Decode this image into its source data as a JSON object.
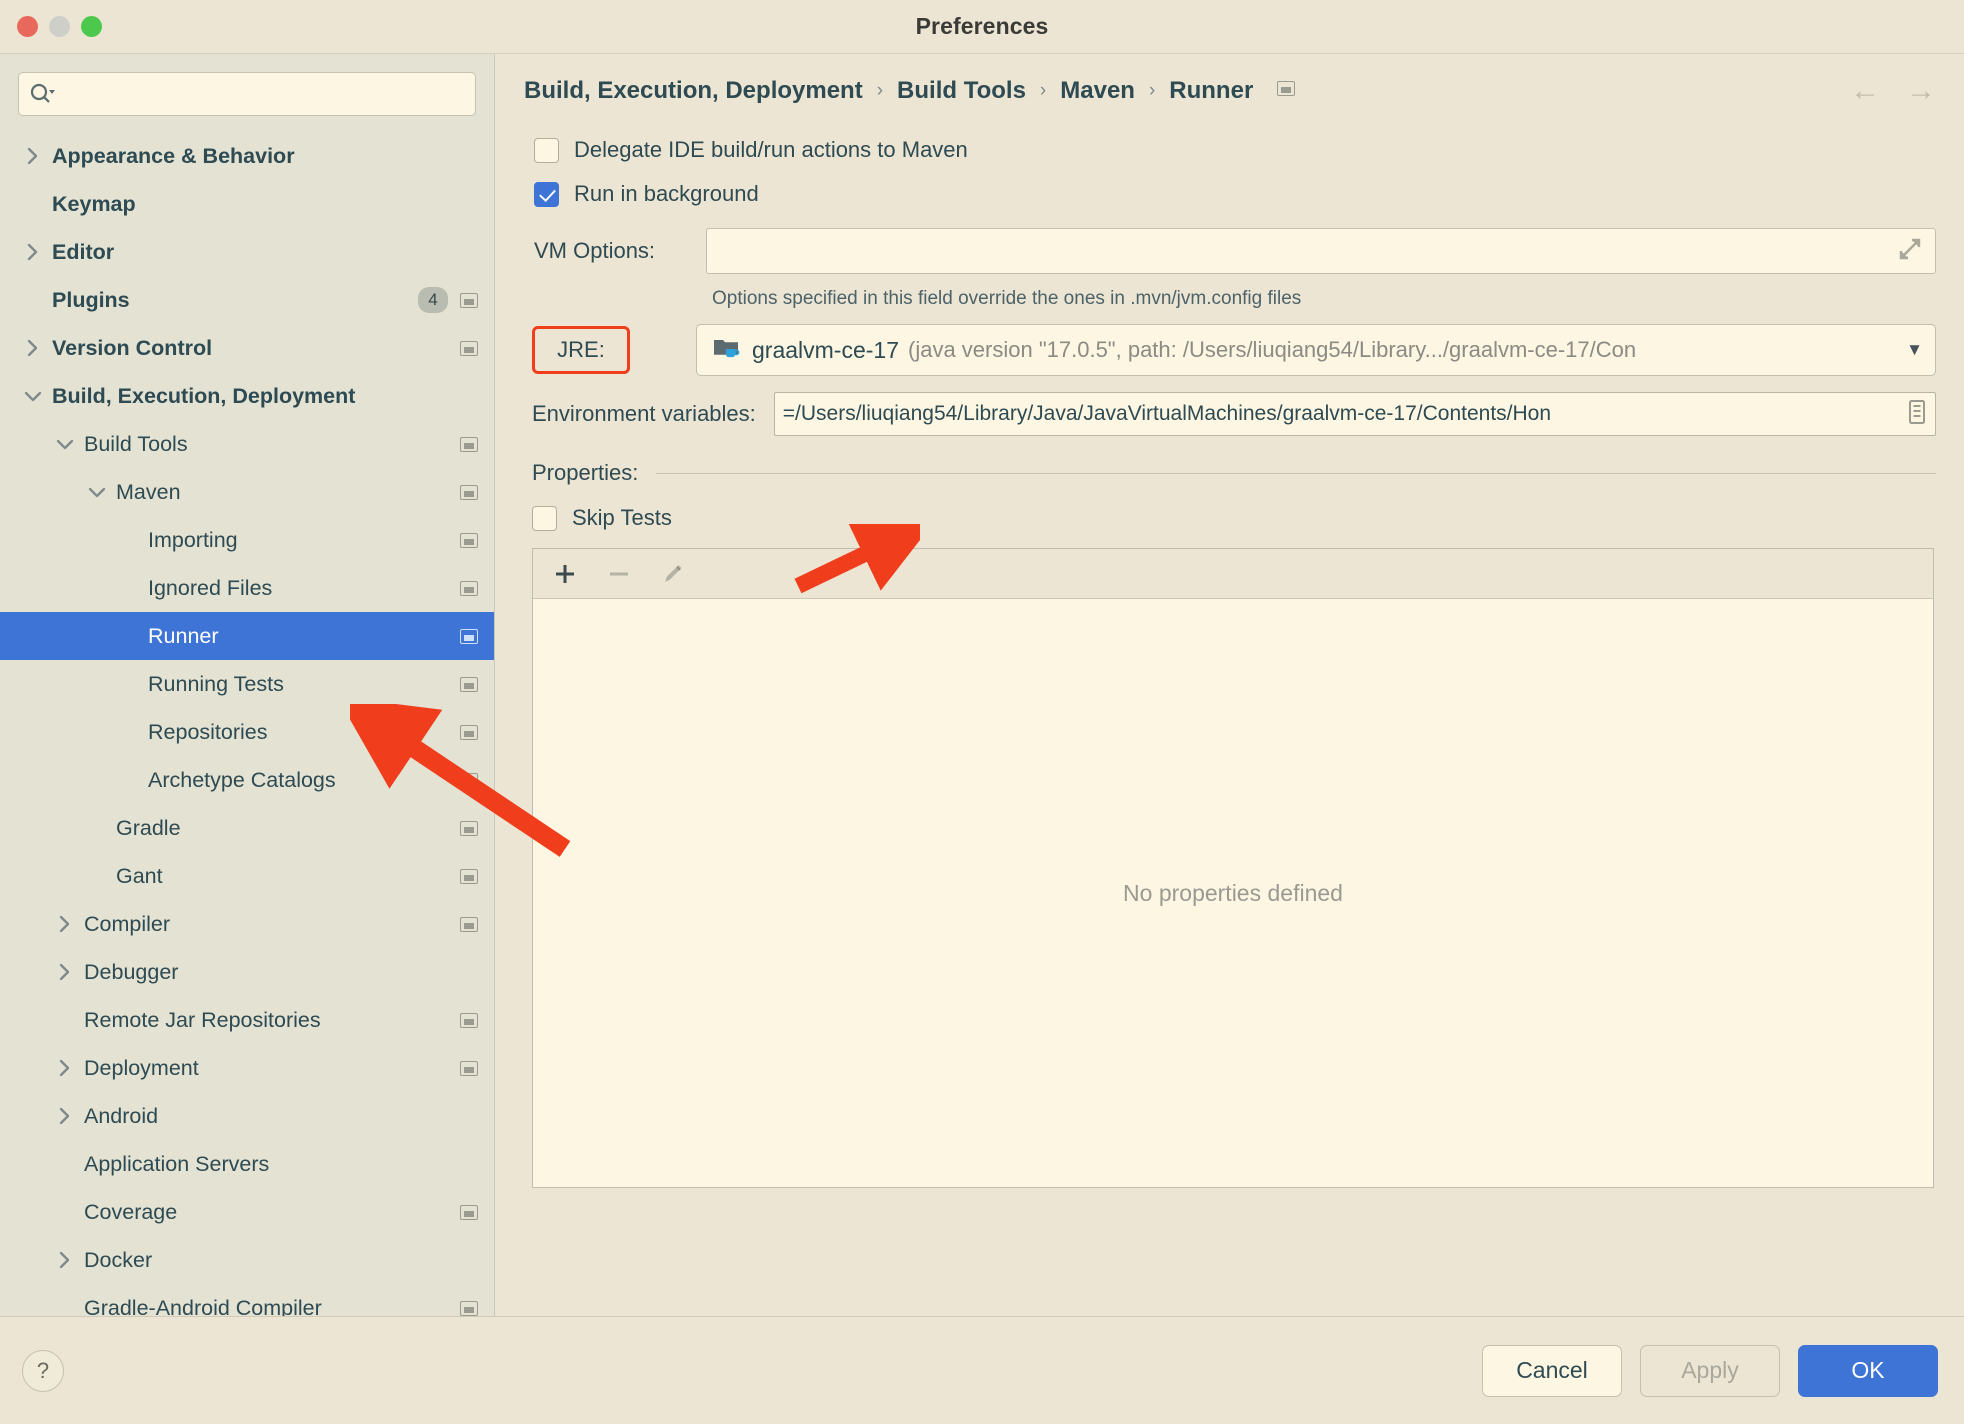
{
  "window": {
    "title": "Preferences",
    "traffic_lights": [
      "close",
      "minimize",
      "maximize"
    ]
  },
  "sidebar": {
    "search": {
      "value": "",
      "placeholder": ""
    },
    "items": [
      {
        "label": "Appearance & Behavior",
        "indent": 0,
        "arrow": "right",
        "bold": true,
        "badge": null,
        "icon": false,
        "selected": false
      },
      {
        "label": "Keymap",
        "indent": 0,
        "arrow": "none",
        "bold": true,
        "badge": null,
        "icon": false,
        "selected": false
      },
      {
        "label": "Editor",
        "indent": 0,
        "arrow": "right",
        "bold": true,
        "badge": null,
        "icon": false,
        "selected": false
      },
      {
        "label": "Plugins",
        "indent": 0,
        "arrow": "none",
        "bold": true,
        "badge": "4",
        "icon": true,
        "selected": false
      },
      {
        "label": "Version Control",
        "indent": 0,
        "arrow": "right",
        "bold": true,
        "badge": null,
        "icon": true,
        "selected": false
      },
      {
        "label": "Build, Execution, Deployment",
        "indent": 0,
        "arrow": "down",
        "bold": true,
        "badge": null,
        "icon": false,
        "selected": false
      },
      {
        "label": "Build Tools",
        "indent": 1,
        "arrow": "down",
        "bold": false,
        "badge": null,
        "icon": true,
        "selected": false
      },
      {
        "label": "Maven",
        "indent": 2,
        "arrow": "down",
        "bold": false,
        "badge": null,
        "icon": true,
        "selected": false
      },
      {
        "label": "Importing",
        "indent": 3,
        "arrow": "none",
        "bold": false,
        "badge": null,
        "icon": true,
        "selected": false
      },
      {
        "label": "Ignored Files",
        "indent": 3,
        "arrow": "none",
        "bold": false,
        "badge": null,
        "icon": true,
        "selected": false
      },
      {
        "label": "Runner",
        "indent": 3,
        "arrow": "none",
        "bold": false,
        "badge": null,
        "icon": true,
        "selected": true
      },
      {
        "label": "Running Tests",
        "indent": 3,
        "arrow": "none",
        "bold": false,
        "badge": null,
        "icon": true,
        "selected": false
      },
      {
        "label": "Repositories",
        "indent": 3,
        "arrow": "none",
        "bold": false,
        "badge": null,
        "icon": true,
        "selected": false
      },
      {
        "label": "Archetype Catalogs",
        "indent": 3,
        "arrow": "none",
        "bold": false,
        "badge": null,
        "icon": true,
        "selected": false
      },
      {
        "label": "Gradle",
        "indent": 2,
        "arrow": "none",
        "bold": false,
        "badge": null,
        "icon": true,
        "selected": false
      },
      {
        "label": "Gant",
        "indent": 2,
        "arrow": "none",
        "bold": false,
        "badge": null,
        "icon": true,
        "selected": false
      },
      {
        "label": "Compiler",
        "indent": 1,
        "arrow": "right",
        "bold": false,
        "badge": null,
        "icon": true,
        "selected": false
      },
      {
        "label": "Debugger",
        "indent": 1,
        "arrow": "right",
        "bold": false,
        "badge": null,
        "icon": false,
        "selected": false
      },
      {
        "label": "Remote Jar Repositories",
        "indent": 1,
        "arrow": "none",
        "bold": false,
        "badge": null,
        "icon": true,
        "selected": false
      },
      {
        "label": "Deployment",
        "indent": 1,
        "arrow": "right",
        "bold": false,
        "badge": null,
        "icon": true,
        "selected": false
      },
      {
        "label": "Android",
        "indent": 1,
        "arrow": "right",
        "bold": false,
        "badge": null,
        "icon": false,
        "selected": false
      },
      {
        "label": "Application Servers",
        "indent": 1,
        "arrow": "none",
        "bold": false,
        "badge": null,
        "icon": false,
        "selected": false
      },
      {
        "label": "Coverage",
        "indent": 1,
        "arrow": "none",
        "bold": false,
        "badge": null,
        "icon": true,
        "selected": false
      },
      {
        "label": "Docker",
        "indent": 1,
        "arrow": "right",
        "bold": false,
        "badge": null,
        "icon": false,
        "selected": false
      },
      {
        "label": "Gradle-Android Compiler",
        "indent": 1,
        "arrow": "none",
        "bold": false,
        "badge": null,
        "icon": true,
        "selected": false
      }
    ]
  },
  "breadcrumb": {
    "parts": [
      "Build, Execution, Deployment",
      "Build Tools",
      "Maven",
      "Runner"
    ],
    "separator": "›",
    "nav_back": "←",
    "nav_forward": "→"
  },
  "main": {
    "delegate_checkbox": {
      "label": "Delegate IDE build/run actions to Maven",
      "checked": false
    },
    "run_in_background": {
      "label": "Run in background",
      "checked": true
    },
    "vm_options": {
      "label": "VM Options:",
      "value": "",
      "placeholder": ""
    },
    "vm_hint": "Options specified in this field override the ones in .mvn/jvm.config files",
    "jre": {
      "label": "JRE:",
      "name": "graalvm-ce-17",
      "detail": "(java version \"17.0.5\", path: /Users/liuqiang54/Library.../graalvm-ce-17/Con",
      "caret": "▼"
    },
    "environment_variables": {
      "label": "Environment variables:",
      "value": "=/Users/liuqiang54/Library/Java/JavaVirtualMachines/graalvm-ce-17/Contents/Hon"
    },
    "properties": {
      "label": "Properties:",
      "skip_tests": {
        "label": "Skip Tests",
        "checked": false
      },
      "toolbar": [
        "add-icon",
        "remove-icon",
        "edit-icon"
      ],
      "empty_message": "No properties defined"
    }
  },
  "footer": {
    "help": "?",
    "cancel": "Cancel",
    "apply": "Apply",
    "ok": "OK"
  },
  "colors": {
    "accent": "#3e74d6",
    "window_bg": "#ece5d3",
    "sidebar_bg": "#e3e2d3",
    "field_bg": "#fcf6e3",
    "text": "#2e4a52",
    "annotation": "#f03d1c"
  }
}
